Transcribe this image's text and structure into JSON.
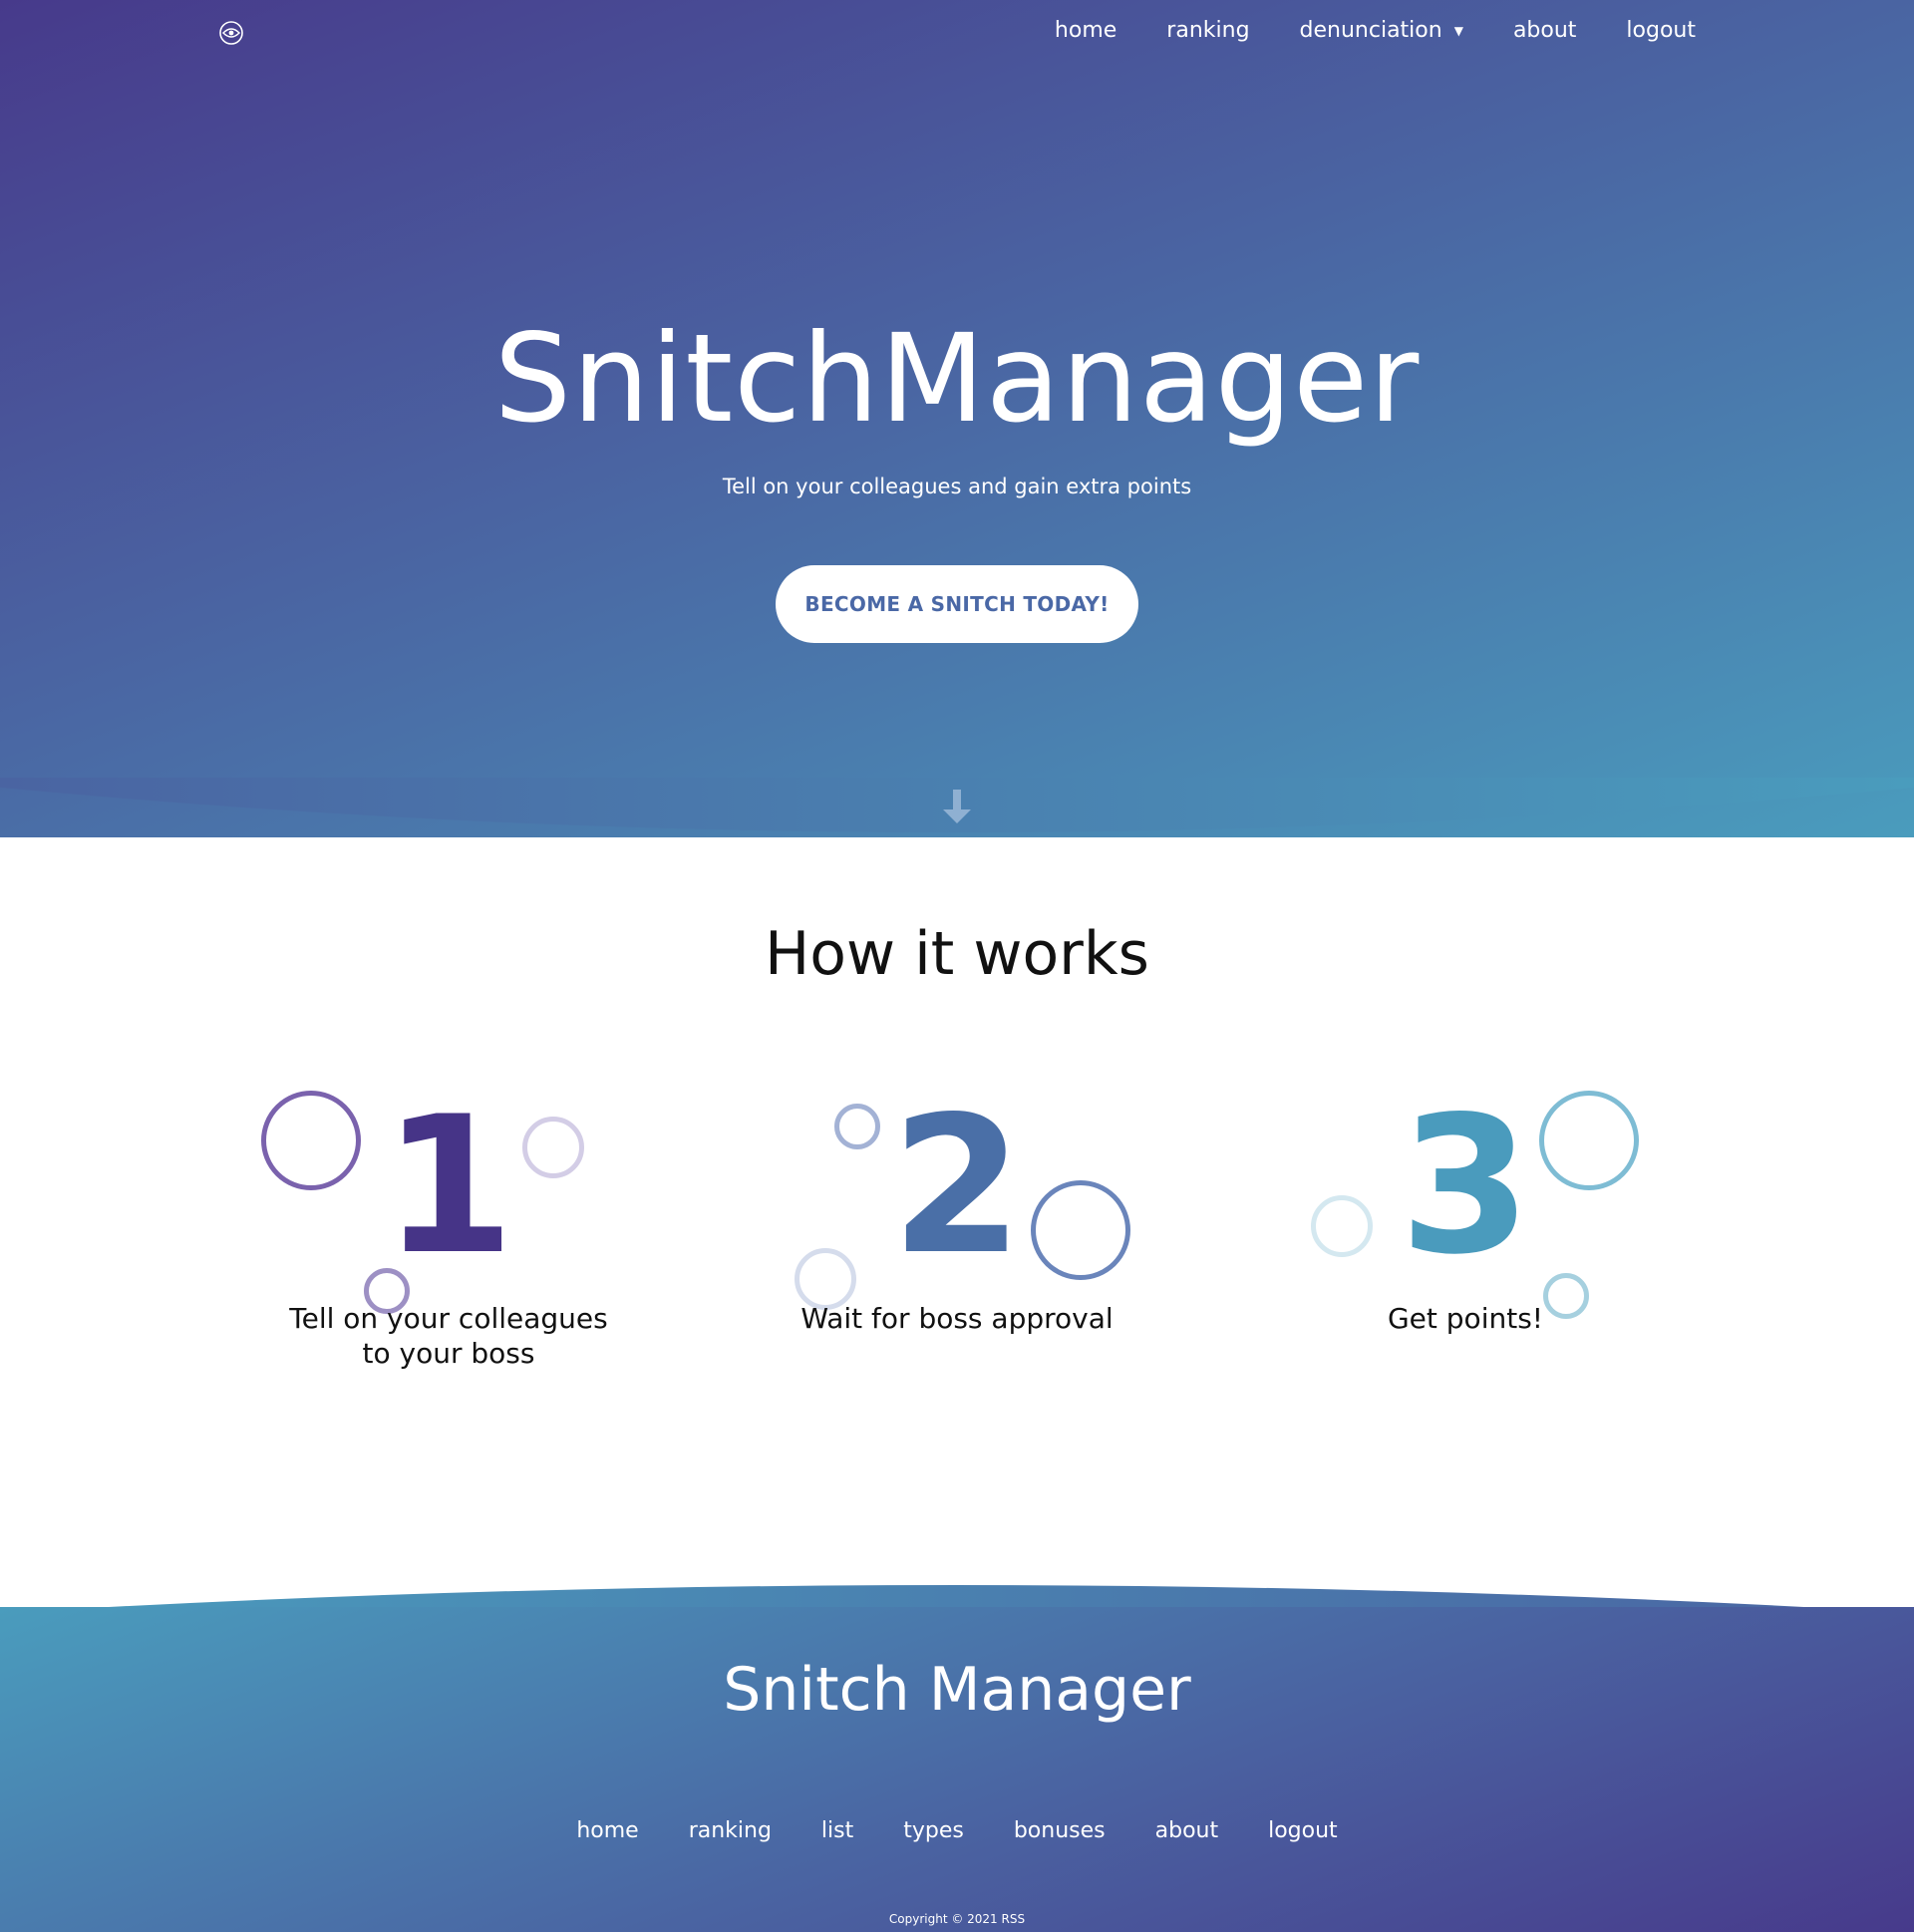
{
  "colors": {
    "gradient_purple": "#473a8b",
    "gradient_blue": "#4a64a2",
    "gradient_teal": "#4a9cbd",
    "step1": "#463487",
    "step2": "#4a6fa7",
    "step3": "#4a9bbd"
  },
  "header": {
    "logo_icon": "eye-icon",
    "nav": {
      "home": "home",
      "ranking": "ranking",
      "denunciation": "denunciation",
      "about": "about",
      "logout": "logout"
    }
  },
  "hero": {
    "title": "SnitchManager",
    "subtitle": "Tell on your colleagues and gain extra points",
    "cta_label": "BECOME A SNITCH TODAY!",
    "scroll_icon": "arrow-down-icon"
  },
  "how": {
    "title": "How it works",
    "steps": [
      {
        "number": "1",
        "text_line1": "Tell on your colleagues",
        "text_line2": "to your boss"
      },
      {
        "number": "2",
        "text_line1": "Wait for boss approval",
        "text_line2": ""
      },
      {
        "number": "3",
        "text_line1": "Get points!",
        "text_line2": ""
      }
    ]
  },
  "footer": {
    "title": "Snitch Manager",
    "nav": {
      "home": "home",
      "ranking": "ranking",
      "list": "list",
      "types": "types",
      "bonuses": "bonuses",
      "about": "about",
      "logout": "logout"
    },
    "copyright": "Copyright © 2021 RSS"
  }
}
